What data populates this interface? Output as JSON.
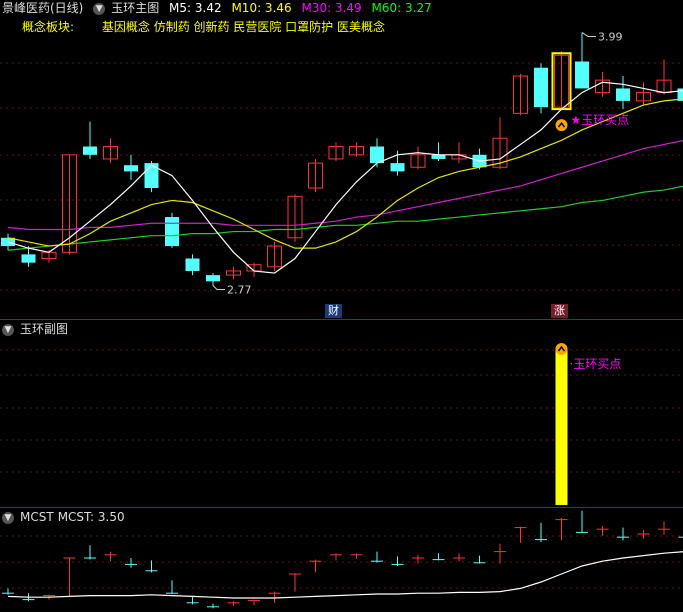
{
  "header_main": {
    "stock_name": "景峰医药(日线)",
    "indicator_name": "玉环主图",
    "ma": [
      {
        "label": "M5: 3.42",
        "color": "#ffffff"
      },
      {
        "label": "M10: 3.46",
        "color": "#ffff00"
      },
      {
        "label": "M30: 3.49",
        "color": "#ff00ff"
      },
      {
        "label": "M60: 3.27",
        "color": "#00ff00"
      }
    ]
  },
  "concept_row": {
    "label": "概念板块:",
    "value": "基因概念 仿制药 创新药 民营医院 口罩防护 医美概念"
  },
  "annotations": {
    "high": "3.99",
    "low": "2.77",
    "buy_main": "玉环买点",
    "buy_sub": "玉环买点",
    "badge_cai": "财",
    "badge_zhang": "涨"
  },
  "header_sub": {
    "name": "玉环副图"
  },
  "header_mcst": {
    "name": "MCST",
    "value_label": "MCST: 3.50"
  },
  "colors": {
    "up": "#ff3232",
    "down": "#54ffff",
    "signal": "#ffff00",
    "buy_text": "#ff00ff"
  },
  "chart_data": {
    "type": "candlestick",
    "candles": [
      {
        "o": 3.0,
        "c": 2.96,
        "h": 3.02,
        "l": 2.94
      },
      {
        "o": 2.92,
        "c": 2.88,
        "h": 2.96,
        "l": 2.86
      },
      {
        "o": 2.9,
        "c": 2.93,
        "h": 2.94,
        "l": 2.88
      },
      {
        "o": 2.93,
        "c": 3.4,
        "h": 3.4,
        "l": 2.92
      },
      {
        "o": 3.44,
        "c": 3.4,
        "h": 3.56,
        "l": 3.38
      },
      {
        "o": 3.38,
        "c": 3.44,
        "h": 3.48,
        "l": 3.36
      },
      {
        "o": 3.35,
        "c": 3.32,
        "h": 3.4,
        "l": 3.28
      },
      {
        "o": 3.36,
        "c": 3.24,
        "h": 3.37,
        "l": 3.22
      },
      {
        "o": 3.1,
        "c": 2.96,
        "h": 3.12,
        "l": 2.95
      },
      {
        "o": 2.9,
        "c": 2.84,
        "h": 2.92,
        "l": 2.82
      },
      {
        "o": 2.82,
        "c": 2.79,
        "h": 2.83,
        "l": 2.77
      },
      {
        "o": 2.82,
        "c": 2.84,
        "h": 2.86,
        "l": 2.8
      },
      {
        "o": 2.84,
        "c": 2.87,
        "h": 2.88,
        "l": 2.81
      },
      {
        "o": 2.86,
        "c": 2.96,
        "h": 2.98,
        "l": 2.84
      },
      {
        "o": 3.0,
        "c": 3.2,
        "h": 3.21,
        "l": 2.98
      },
      {
        "o": 3.24,
        "c": 3.36,
        "h": 3.38,
        "l": 3.22
      },
      {
        "o": 3.38,
        "c": 3.44,
        "h": 3.46,
        "l": 3.37
      },
      {
        "o": 3.4,
        "c": 3.44,
        "h": 3.46,
        "l": 3.39
      },
      {
        "o": 3.44,
        "c": 3.36,
        "h": 3.48,
        "l": 3.34
      },
      {
        "o": 3.36,
        "c": 3.32,
        "h": 3.42,
        "l": 3.3
      },
      {
        "o": 3.34,
        "c": 3.4,
        "h": 3.44,
        "l": 3.33
      },
      {
        "o": 3.4,
        "c": 3.38,
        "h": 3.46,
        "l": 3.37
      },
      {
        "o": 3.38,
        "c": 3.4,
        "h": 3.46,
        "l": 3.36
      },
      {
        "o": 3.4,
        "c": 3.34,
        "h": 3.43,
        "l": 3.33
      },
      {
        "o": 3.34,
        "c": 3.48,
        "h": 3.58,
        "l": 3.33
      },
      {
        "o": 3.6,
        "c": 3.78,
        "h": 3.79,
        "l": 3.59
      },
      {
        "o": 3.82,
        "c": 3.63,
        "h": 3.84,
        "l": 3.6
      },
      {
        "o": 3.63,
        "c": 3.88,
        "h": 3.9,
        "l": 3.62
      },
      {
        "o": 3.85,
        "c": 3.72,
        "h": 3.99,
        "l": 3.72
      },
      {
        "o": 3.7,
        "c": 3.76,
        "h": 3.8,
        "l": 3.68
      },
      {
        "o": 3.72,
        "c": 3.66,
        "h": 3.78,
        "l": 3.62
      },
      {
        "o": 3.66,
        "c": 3.7,
        "h": 3.75,
        "l": 3.64
      },
      {
        "o": 3.7,
        "c": 3.76,
        "h": 3.86,
        "l": 3.69
      },
      {
        "o": 3.72,
        "c": 3.66,
        "h": 3.76,
        "l": 3.64
      },
      {
        "o": 3.7,
        "c": 3.74,
        "h": 3.8,
        "l": 3.68
      }
    ],
    "ma5": [
      2.98,
      2.95,
      2.93,
      3.0,
      3.08,
      3.16,
      3.25,
      3.35,
      3.3,
      3.18,
      3.05,
      2.93,
      2.84,
      2.83,
      2.9,
      3.03,
      3.16,
      3.27,
      3.36,
      3.4,
      3.41,
      3.4,
      3.4,
      3.37,
      3.38,
      3.45,
      3.52,
      3.62,
      3.7,
      3.75,
      3.74,
      3.72,
      3.7,
      3.71,
      3.7
    ],
    "ma10": [
      3.0,
      2.98,
      2.96,
      2.97,
      3.02,
      3.08,
      3.12,
      3.16,
      3.18,
      3.17,
      3.13,
      3.09,
      3.04,
      2.99,
      2.95,
      2.95,
      2.98,
      3.03,
      3.1,
      3.18,
      3.24,
      3.29,
      3.32,
      3.34,
      3.36,
      3.39,
      3.43,
      3.47,
      3.52,
      3.56,
      3.6,
      3.64,
      3.66,
      3.67,
      3.68
    ],
    "ma30": [
      3.05,
      3.04,
      3.04,
      3.04,
      3.05,
      3.05,
      3.06,
      3.07,
      3.07,
      3.07,
      3.07,
      3.06,
      3.06,
      3.06,
      3.06,
      3.07,
      3.08,
      3.1,
      3.11,
      3.13,
      3.15,
      3.17,
      3.19,
      3.21,
      3.23,
      3.25,
      3.28,
      3.31,
      3.34,
      3.37,
      3.4,
      3.43,
      3.45,
      3.47,
      3.49
    ],
    "ma60": [
      2.94,
      2.95,
      2.96,
      2.97,
      2.98,
      2.99,
      3.0,
      3.01,
      3.01,
      3.02,
      3.02,
      3.03,
      3.03,
      3.04,
      3.04,
      3.05,
      3.06,
      3.06,
      3.07,
      3.08,
      3.08,
      3.09,
      3.1,
      3.11,
      3.12,
      3.13,
      3.14,
      3.15,
      3.17,
      3.18,
      3.2,
      3.22,
      3.23,
      3.25,
      3.27
    ],
    "ylim": [
      2.7,
      4.05
    ],
    "buy_index": 27,
    "mcst": [
      2.92,
      2.91,
      2.91,
      2.92,
      2.93,
      2.93,
      2.93,
      2.94,
      2.93,
      2.92,
      2.91,
      2.9,
      2.9,
      2.9,
      2.91,
      2.92,
      2.93,
      2.94,
      2.95,
      2.95,
      2.96,
      2.96,
      2.97,
      2.97,
      2.98,
      3.02,
      3.1,
      3.2,
      3.3,
      3.36,
      3.4,
      3.43,
      3.46,
      3.48,
      3.5
    ],
    "mcst_ylim": [
      2.75,
      3.85
    ]
  }
}
